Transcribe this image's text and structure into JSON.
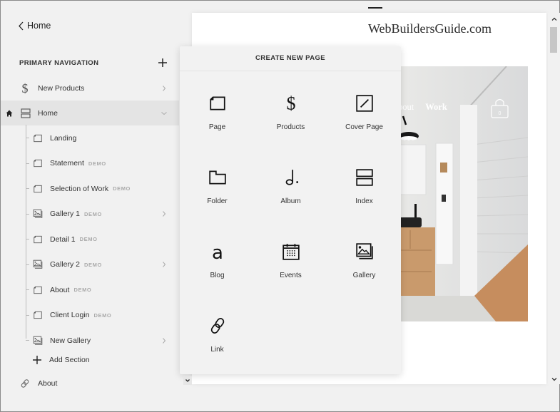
{
  "sidebar": {
    "back_label": "Home",
    "heading": "PRIMARY NAVIGATION",
    "items": [
      {
        "label": "New Products",
        "icon": "dollar-icon",
        "has_chevron": true,
        "chevron": "right"
      },
      {
        "label": "Home",
        "icon": "index-icon",
        "has_chevron": true,
        "chevron": "down",
        "selected": true,
        "is_homepage": true
      }
    ],
    "children": [
      {
        "label": "Landing",
        "icon": "page-icon",
        "demo": null,
        "has_chevron": false
      },
      {
        "label": "Statement",
        "icon": "page-icon",
        "demo": "DEMO",
        "has_chevron": false
      },
      {
        "label": "Selection of Work",
        "icon": "page-icon",
        "demo": "DEMO",
        "has_chevron": false
      },
      {
        "label": "Gallery 1",
        "icon": "gallery-icon",
        "demo": "DEMO",
        "has_chevron": true
      },
      {
        "label": "Detail 1",
        "icon": "page-icon",
        "demo": "DEMO",
        "has_chevron": false
      },
      {
        "label": "Gallery 2",
        "icon": "gallery-icon",
        "demo": "DEMO",
        "has_chevron": true
      },
      {
        "label": "About",
        "icon": "page-icon",
        "demo": "DEMO",
        "has_chevron": false
      },
      {
        "label": "Client Login",
        "icon": "page-icon",
        "demo": "DEMO",
        "has_chevron": false
      },
      {
        "label": "New Gallery",
        "icon": "gallery-icon",
        "demo": null,
        "has_chevron": true
      }
    ],
    "add_section_label": "Add Section",
    "footer_item": {
      "label": "About",
      "icon": "link-icon"
    }
  },
  "popover": {
    "title": "CREATE NEW PAGE",
    "types": [
      {
        "label": "Page",
        "icon": "page-icon"
      },
      {
        "label": "Products",
        "icon": "dollar-icon"
      },
      {
        "label": "Cover Page",
        "icon": "cover-page-icon"
      },
      {
        "label": "Folder",
        "icon": "folder-icon"
      },
      {
        "label": "Album",
        "icon": "music-note-icon"
      },
      {
        "label": "Index",
        "icon": "index-icon"
      },
      {
        "label": "Blog",
        "icon": "blog-icon"
      },
      {
        "label": "Events",
        "icon": "calendar-icon"
      },
      {
        "label": "Gallery",
        "icon": "gallery-icon"
      },
      {
        "label": "Link",
        "icon": "link-icon"
      }
    ]
  },
  "preview": {
    "site_title": "WebBuildersGuide.com",
    "nav": [
      "About",
      "Work"
    ],
    "cart_count": "0"
  }
}
